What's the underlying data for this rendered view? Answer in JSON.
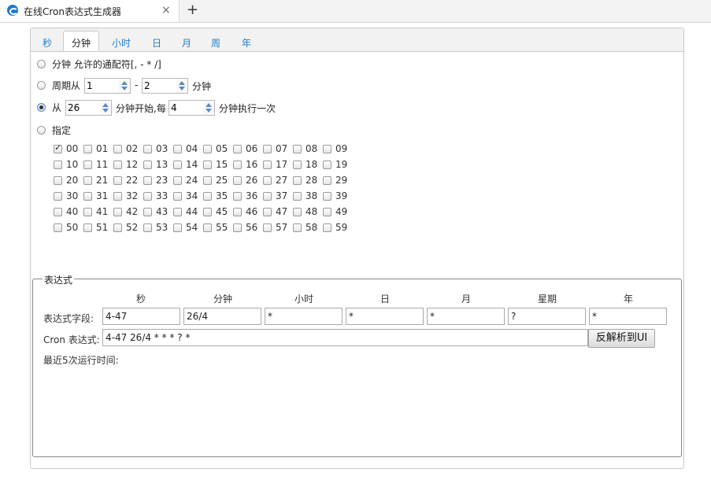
{
  "browser": {
    "tab_title": "在线Cron表达式生成器",
    "close_glyph": "×",
    "new_tab_glyph": "+"
  },
  "tabs": [
    "秒",
    "分钟",
    "小时",
    "日",
    "月",
    "周",
    "年"
  ],
  "active_tab_index": 1,
  "options": {
    "any": "分钟 允许的通配符[, - * /]",
    "range_prefix": "周期从",
    "range_from": "1",
    "range_dash": "-",
    "range_to": "2",
    "range_suffix": "分钟",
    "incr_prefix": "从",
    "incr_start": "26",
    "incr_mid": "分钟开始,每",
    "incr_step": "4",
    "incr_suffix": "分钟执行一次",
    "specify": "指定",
    "selected": "increment"
  },
  "minute_checkboxes": [
    "00",
    "01",
    "02",
    "03",
    "04",
    "05",
    "06",
    "07",
    "08",
    "09",
    "10",
    "11",
    "12",
    "13",
    "14",
    "15",
    "16",
    "17",
    "18",
    "19",
    "20",
    "21",
    "22",
    "23",
    "24",
    "25",
    "26",
    "27",
    "28",
    "29",
    "30",
    "31",
    "32",
    "33",
    "34",
    "35",
    "36",
    "37",
    "38",
    "39",
    "40",
    "41",
    "42",
    "43",
    "44",
    "45",
    "46",
    "47",
    "48",
    "49",
    "50",
    "51",
    "52",
    "53",
    "54",
    "55",
    "56",
    "57",
    "58",
    "59"
  ],
  "checked_minutes": [
    "00"
  ],
  "expression": {
    "legend": "表达式",
    "columns": [
      "秒",
      "分钟",
      "小时",
      "日",
      "月",
      "星期",
      "年"
    ],
    "fields_label": "表达式字段:",
    "fields": [
      "4-47",
      "26/4",
      "*",
      "*",
      "*",
      "?",
      "*"
    ],
    "cron_label": "Cron 表达式:",
    "cron_value": "4-47 26/4 * * * ? *",
    "parse_button": "反解析到UI",
    "recent_label": "最近5次运行时间:"
  }
}
